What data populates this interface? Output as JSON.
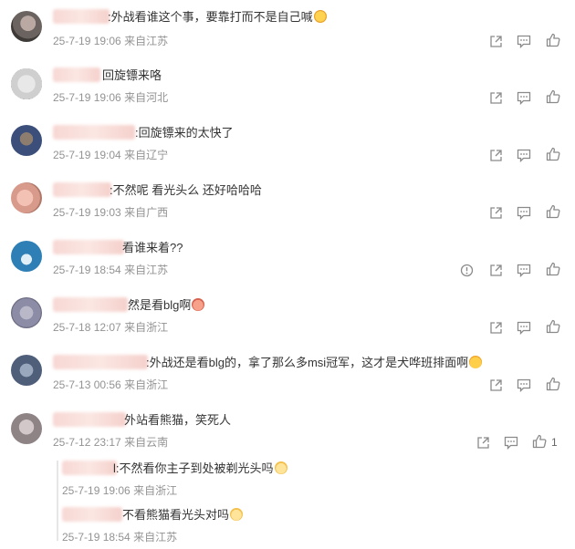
{
  "comments": [
    {
      "text": ":外战看谁这个事，要靠打而不是自己喊",
      "emoji": "cry-laugh",
      "date": "25-7-19 19:06",
      "location": "来自江苏",
      "likes": ""
    },
    {
      "text": "回旋镖来咯",
      "emoji": "",
      "date": "25-7-19 19:06",
      "location": "来自河北",
      "likes": ""
    },
    {
      "text": ":回旋镖来的太快了",
      "emoji": "",
      "date": "25-7-19 19:04",
      "location": "来自辽宁",
      "likes": ""
    },
    {
      "text": ":不然呢 看光头么  还好哈哈哈",
      "emoji": "",
      "date": "25-7-19 19:03",
      "location": "来自广西",
      "likes": ""
    },
    {
      "text": "看谁来着??",
      "emoji": "",
      "date": "25-7-19 18:54",
      "location": "来自江苏",
      "likes": ""
    },
    {
      "text": "然是看blg啊",
      "emoji": "pig",
      "date": "25-7-18 12:07",
      "location": "来自浙江",
      "likes": ""
    },
    {
      "text": ":外战还是看blg的，拿了那么多msi冠军，这才是犬哗班排面啊",
      "emoji": "laugh",
      "date": "25-7-13 00:56",
      "location": "来自浙江",
      "likes": ""
    },
    {
      "text": "外站看熊猫，笑死人",
      "emoji": "",
      "date": "25-7-12 23:17",
      "location": "来自云南",
      "likes": "1"
    }
  ],
  "replies": [
    {
      "text": "l:不然看你主子到处被剃光头吗",
      "emoji": "cat",
      "date": "25-7-19 19:06",
      "location": "来自浙江"
    },
    {
      "text": "不看熊猫看光头对吗",
      "emoji": "cat",
      "date": "25-7-19 18:54",
      "location": "来自江苏"
    }
  ],
  "icons": {
    "share": "share-icon",
    "comment": "comment-icon",
    "like": "thumbs-up-icon",
    "report": "report-icon"
  },
  "colors": {
    "text": "#333333",
    "meta": "#939393",
    "icon": "#8a8a8a"
  }
}
